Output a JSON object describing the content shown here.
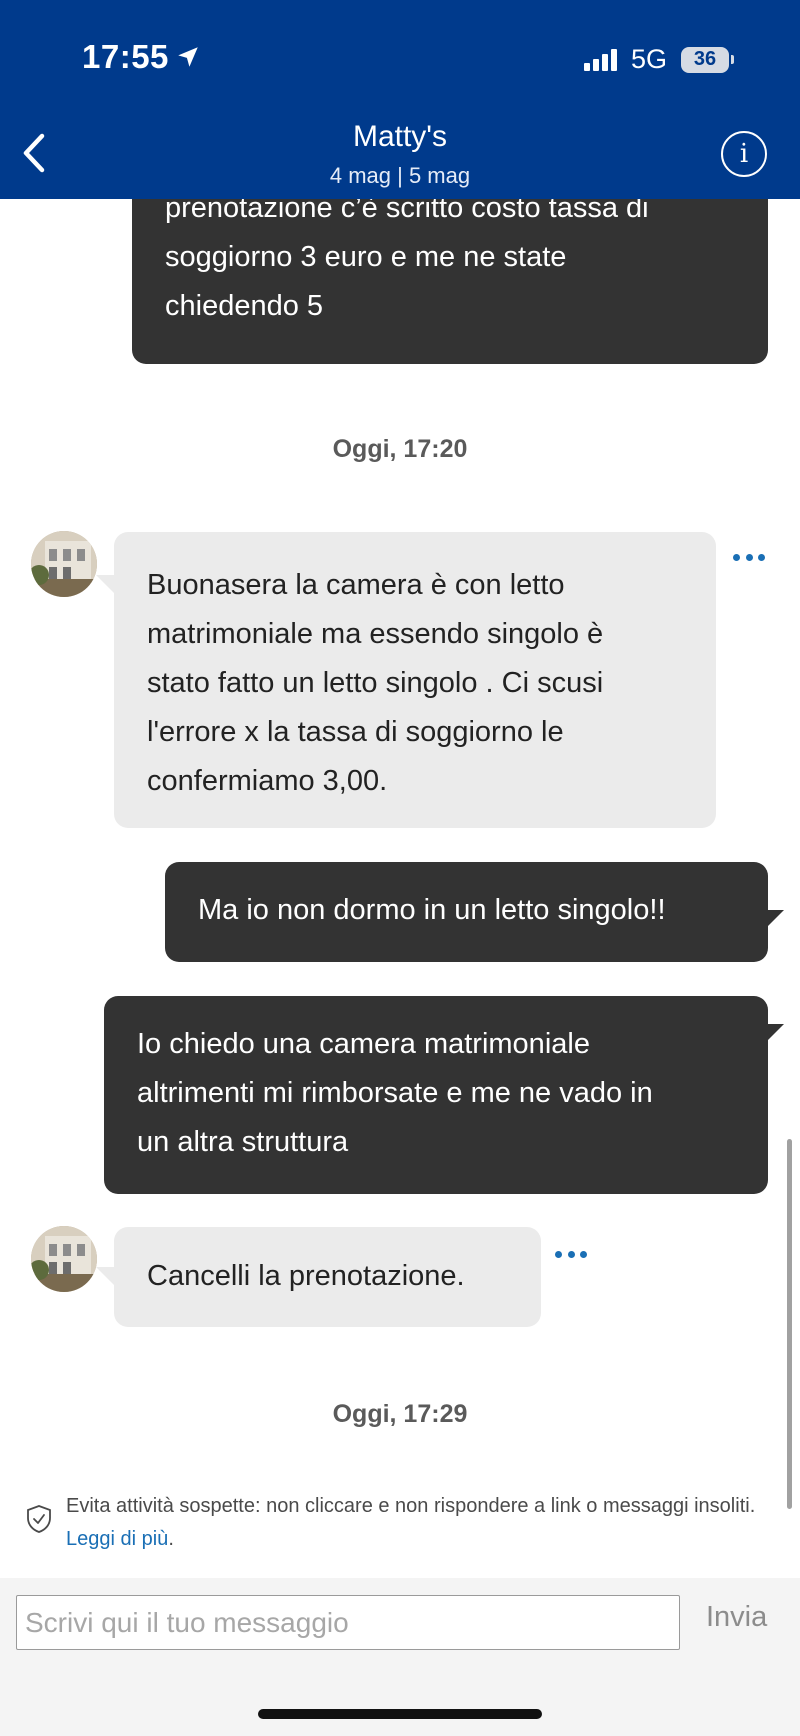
{
  "status_bar": {
    "time": "17:55",
    "network": "5G",
    "battery": "36"
  },
  "header": {
    "title": "Matty's",
    "subtitle": "4 mag | 5 mag"
  },
  "messages": [
    {
      "direction": "outgoing",
      "lines": [
        "prenotazione c’è scritto costo tassa di",
        "soggiorno 3 euro e me ne state",
        "chiedendo 5"
      ]
    },
    {
      "direction": "incoming",
      "lines": [
        "Buonasera la camera è con letto",
        "matrimoniale ma essendo singolo è",
        "stato fatto un letto singolo . Ci scusi",
        "l'errore x la tassa di soggiorno le",
        "confermiamo 3,00."
      ]
    },
    {
      "direction": "outgoing",
      "lines": [
        "Ma io non dormo in un letto singolo!!"
      ]
    },
    {
      "direction": "outgoing",
      "lines": [
        "Io chiedo una camera matrimoniale",
        "altrimenti mi rimborsate e me ne vado in",
        "un altra struttura"
      ]
    },
    {
      "direction": "incoming",
      "lines": [
        "Cancelli la prenotazione."
      ]
    }
  ],
  "timestamps": [
    "Oggi, 17:20",
    "Oggi, 17:29"
  ],
  "notice": {
    "text": "Evita attività sospette: non cliccare e non rispondere a link o messaggi insoliti. ",
    "link": "Leggi di più",
    "end": "."
  },
  "composer": {
    "placeholder": "Scrivi qui il tuo messaggio",
    "send_label": "Invia"
  },
  "colors": {
    "header_bg": "#003a8c",
    "outgoing_bubble": "#333333",
    "incoming_bubble": "#ebebeb",
    "link": "#1a6fb5"
  },
  "icons": [
    "location-arrow-icon",
    "signal-icon",
    "battery-icon",
    "back-chevron-icon",
    "info-icon",
    "more-options-icon",
    "shield-check-icon"
  ]
}
